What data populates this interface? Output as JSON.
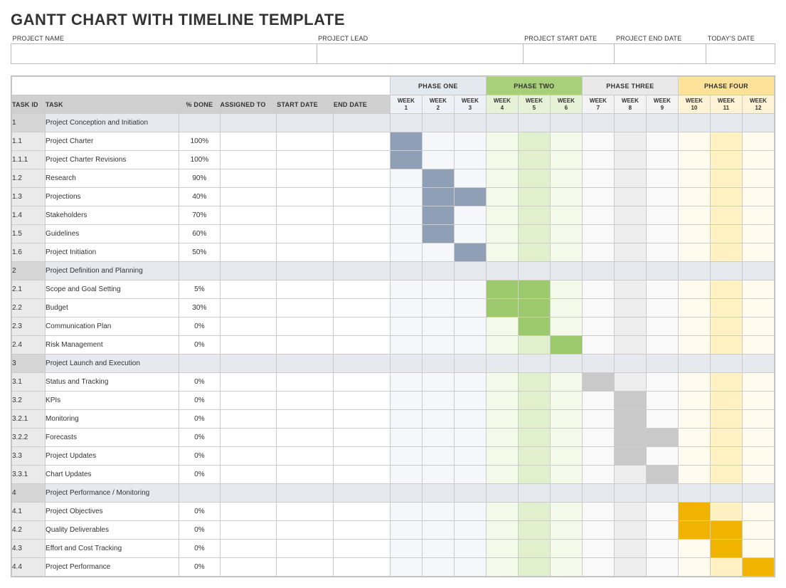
{
  "title": "GANTT CHART WITH TIMELINE TEMPLATE",
  "meta_headers": {
    "project_name": "PROJECT NAME",
    "project_lead": "PROJECT LEAD",
    "project_start": "PROJECT START DATE",
    "project_end": "PROJECT END DATE",
    "todays_date": "TODAY'S DATE"
  },
  "col_headers": {
    "task_id": "TASK ID",
    "task": "TASK",
    "pct_done": "% DONE",
    "assigned_to": "ASSIGNED TO",
    "start_date": "START DATE",
    "end_date": "END DATE"
  },
  "week_label": "WEEK",
  "phases": [
    {
      "name": "PHASE ONE",
      "weeks": [
        1,
        2,
        3
      ]
    },
    {
      "name": "PHASE TWO",
      "weeks": [
        4,
        5,
        6
      ]
    },
    {
      "name": "PHASE THREE",
      "weeks": [
        7,
        8,
        9
      ]
    },
    {
      "name": "PHASE FOUR",
      "weeks": [
        10,
        11,
        12
      ]
    }
  ],
  "chart_data": {
    "type": "gantt",
    "x_units": "week",
    "x_range": [
      1,
      12
    ],
    "rows": [
      {
        "id": "1",
        "task": "Project Conception and Initiation",
        "section": true
      },
      {
        "id": "1.1",
        "task": "Project Charter",
        "pct": "100%",
        "bars": [
          [
            1,
            1,
            1
          ]
        ]
      },
      {
        "id": "1.1.1",
        "task": "Project Charter Revisions",
        "pct": "100%",
        "bars": [
          [
            1,
            1,
            1
          ]
        ]
      },
      {
        "id": "1.2",
        "task": "Research",
        "pct": "90%",
        "bars": [
          [
            2,
            2,
            1
          ]
        ]
      },
      {
        "id": "1.3",
        "task": "Projections",
        "pct": "40%",
        "bars": [
          [
            2,
            3,
            1
          ]
        ]
      },
      {
        "id": "1.4",
        "task": "Stakeholders",
        "pct": "70%",
        "bars": [
          [
            2,
            2,
            1
          ]
        ]
      },
      {
        "id": "1.5",
        "task": "Guidelines",
        "pct": "60%",
        "bars": [
          [
            2,
            2,
            1
          ]
        ]
      },
      {
        "id": "1.6",
        "task": "Project Initiation",
        "pct": "50%",
        "bars": [
          [
            3,
            3,
            1
          ]
        ]
      },
      {
        "id": "2",
        "task": "Project Definition and Planning",
        "section": true
      },
      {
        "id": "2.1",
        "task": "Scope and Goal Setting",
        "pct": "5%",
        "bars": [
          [
            4,
            5,
            2
          ]
        ]
      },
      {
        "id": "2.2",
        "task": "Budget",
        "pct": "30%",
        "bars": [
          [
            4,
            5,
            2
          ]
        ]
      },
      {
        "id": "2.3",
        "task": "Communication Plan",
        "pct": "0%",
        "bars": [
          [
            5,
            5,
            2
          ]
        ]
      },
      {
        "id": "2.4",
        "task": "Risk Management",
        "pct": "0%",
        "bars": [
          [
            6,
            6,
            2
          ]
        ]
      },
      {
        "id": "3",
        "task": "Project Launch and Execution",
        "section": true
      },
      {
        "id": "3.1",
        "task": "Status and Tracking",
        "pct": "0%",
        "bars": [
          [
            7,
            7,
            3
          ]
        ]
      },
      {
        "id": "3.2",
        "task": "KPIs",
        "pct": "0%",
        "bars": [
          [
            8,
            8,
            3
          ]
        ]
      },
      {
        "id": "3.2.1",
        "task": "Monitoring",
        "pct": "0%",
        "bars": [
          [
            8,
            8,
            3
          ]
        ]
      },
      {
        "id": "3.2.2",
        "task": "Forecasts",
        "pct": "0%",
        "bars": [
          [
            8,
            9,
            3
          ]
        ]
      },
      {
        "id": "3.3",
        "task": "Project Updates",
        "pct": "0%",
        "bars": [
          [
            8,
            8,
            3
          ]
        ]
      },
      {
        "id": "3.3.1",
        "task": "Chart Updates",
        "pct": "0%",
        "bars": [
          [
            9,
            9,
            3
          ]
        ]
      },
      {
        "id": "4",
        "task": "Project Performance / Monitoring",
        "section": true
      },
      {
        "id": "4.1",
        "task": "Project Objectives",
        "pct": "0%",
        "bars": [
          [
            10,
            10,
            4
          ]
        ]
      },
      {
        "id": "4.2",
        "task": "Quality Deliverables",
        "pct": "0%",
        "bars": [
          [
            10,
            11,
            4
          ]
        ]
      },
      {
        "id": "4.3",
        "task": "Effort and Cost Tracking",
        "pct": "0%",
        "bars": [
          [
            11,
            11,
            4
          ]
        ]
      },
      {
        "id": "4.4",
        "task": "Project Performance",
        "pct": "0%",
        "bars": [
          [
            12,
            12,
            4
          ]
        ]
      }
    ]
  }
}
